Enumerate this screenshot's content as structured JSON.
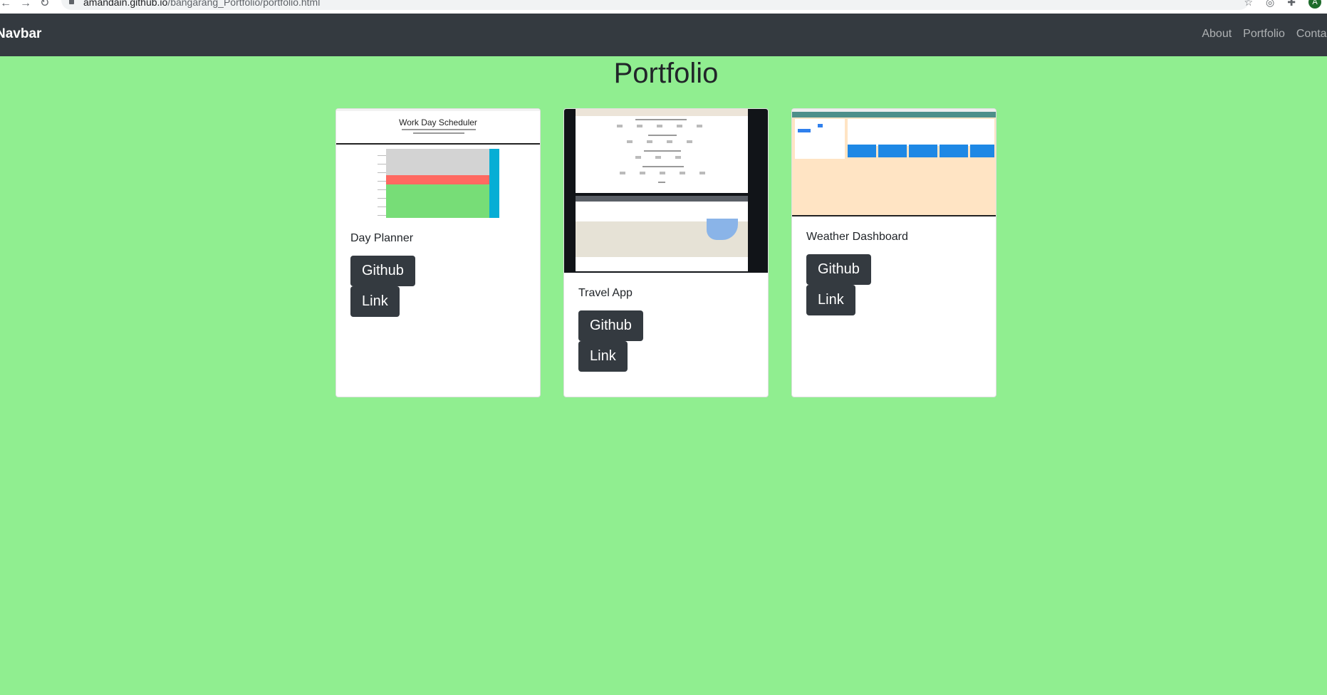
{
  "browser": {
    "url_host": "amandain.github.io",
    "url_path": "/bangarang_Portfolio/portfolio.html"
  },
  "navbar": {
    "brand": "Navbar",
    "links": [
      "About",
      "Portfolio",
      "Contact"
    ]
  },
  "page": {
    "title": "Portfolio"
  },
  "cards": [
    {
      "title": "Day Planner",
      "thumbnail_heading": "Work Day Scheduler",
      "github_label": "Github",
      "link_label": "Link"
    },
    {
      "title": "Travel App",
      "github_label": "Github",
      "link_label": "Link"
    },
    {
      "title": "Weather Dashboard",
      "github_label": "Github",
      "link_label": "Link"
    }
  ],
  "colors": {
    "page_background": "#90ee90",
    "navbar_background": "#343a40",
    "button_background": "#343a40"
  }
}
